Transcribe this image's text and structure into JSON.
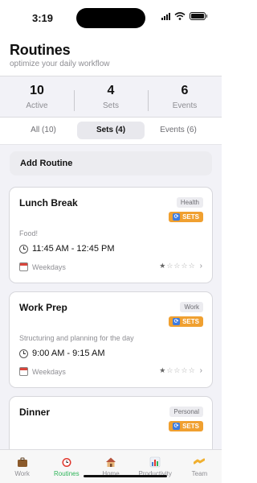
{
  "status": {
    "time": "3:19"
  },
  "header": {
    "title": "Routines",
    "subtitle": "optimize your daily workflow"
  },
  "stats": [
    {
      "value": "10",
      "label": "Active"
    },
    {
      "value": "4",
      "label": "Sets"
    },
    {
      "value": "6",
      "label": "Events"
    }
  ],
  "tabs": [
    {
      "label": "All (10)",
      "active": false
    },
    {
      "label": "Sets (4)",
      "active": true
    },
    {
      "label": "Events (6)",
      "active": false
    }
  ],
  "add_routine": "Add Routine",
  "routines": [
    {
      "name": "Lunch Break",
      "category": "Health",
      "badge": "SETS",
      "description": "Food!",
      "time": "11:45 AM - 12:45 PM",
      "days": "Weekdays",
      "rating": 1,
      "max_rating": 5
    },
    {
      "name": "Work Prep",
      "category": "Work",
      "badge": "SETS",
      "description": "Structuring and planning for the day",
      "time": "9:00 AM - 9:15 AM",
      "days": "Weekdays",
      "rating": 1,
      "max_rating": 5
    },
    {
      "name": "Dinner",
      "category": "Personal",
      "badge": "SETS",
      "description": "",
      "time": "",
      "days": "",
      "rating": 0,
      "max_rating": 5
    }
  ],
  "tabbar": [
    {
      "label": "Work",
      "icon": "briefcase-icon",
      "color": "#8b5a2b",
      "active": false
    },
    {
      "label": "Routines",
      "icon": "alarm-clock-icon",
      "color": "#e0352b",
      "active": true
    },
    {
      "label": "Home",
      "icon": "house-icon",
      "color": "#c98a4a",
      "active": false
    },
    {
      "label": "Productivity",
      "icon": "bar-chart-icon",
      "color": "#4a7fd0",
      "active": false
    },
    {
      "label": "Team",
      "icon": "handshake-icon",
      "color": "#f0b030",
      "active": false
    }
  ],
  "colors": {
    "accent": "#2fb55a",
    "badge": "#f0a030"
  }
}
